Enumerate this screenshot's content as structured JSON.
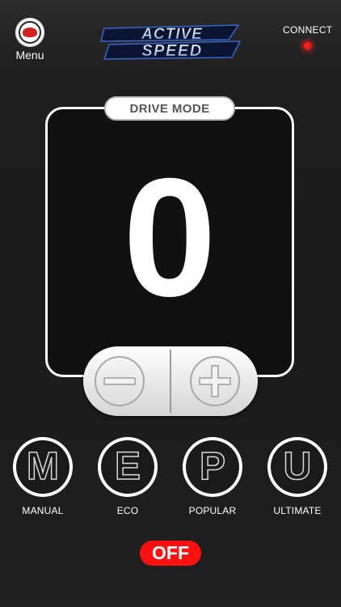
{
  "header": {
    "menu_label": "Menu",
    "brand_line1": "ACTIVE",
    "brand_line2": "SPEED",
    "connect_label": "CONNECT",
    "connect_led_color": "#ff1a1a"
  },
  "drive_mode": {
    "title": "DRIVE MODE",
    "value": "0",
    "decrement_icon": "minus-icon",
    "increment_icon": "plus-icon"
  },
  "modes": [
    {
      "letter": "M",
      "label": "MANUAL"
    },
    {
      "letter": "E",
      "label": "ECO"
    },
    {
      "letter": "P",
      "label": "POPULAR"
    },
    {
      "letter": "U",
      "label": "ULTIMATE"
    }
  ],
  "power": {
    "label": "OFF",
    "color": "#ff1010"
  }
}
